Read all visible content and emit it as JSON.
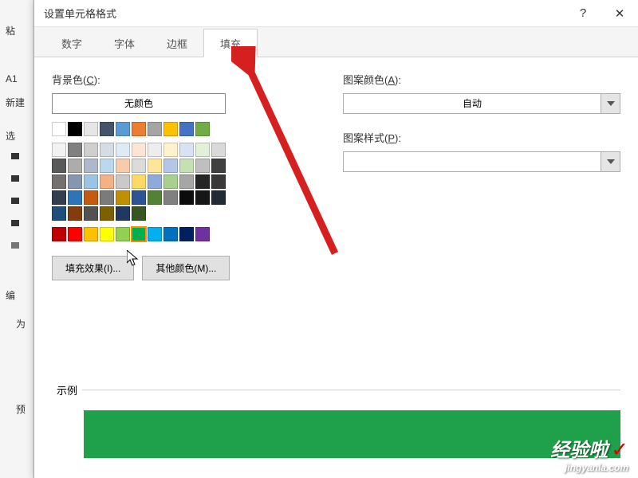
{
  "bg": {
    "paste": "粘",
    "a1": "A1",
    "new": "新建",
    "select": "选",
    "edit": "编",
    "for": "为",
    "preview": "预"
  },
  "dialog": {
    "title": "设置单元格格式",
    "help": "?",
    "close": "✕"
  },
  "tabs": {
    "number": "数字",
    "font": "字体",
    "border": "边框",
    "fill": "填充"
  },
  "fill": {
    "bg_label_pre": "背景色(",
    "bg_label_u": "C",
    "bg_label_post": "):",
    "no_color": "无颜色",
    "fill_effects": "填充效果(I)...",
    "more_colors": "其他颜色(M)...",
    "pattern_color_pre": "图案颜色(",
    "pattern_color_u": "A",
    "pattern_color_post": "):",
    "auto": "自动",
    "pattern_style_pre": "图案样式(",
    "pattern_style_u": "P",
    "pattern_style_post": "):",
    "sample": "示例"
  },
  "palette": {
    "row1": [
      "#ffffff",
      "#000000",
      "#e7e6e6",
      "#44546a",
      "#5b9bd5",
      "#ed7d31",
      "#a5a5a5",
      "#ffc000",
      "#4472c4",
      "#70ad47"
    ],
    "theme": [
      [
        "#f2f2f2",
        "#808080",
        "#d0cece",
        "#d6dce4",
        "#deebf6",
        "#fbe5d5",
        "#ededed",
        "#fff2cc",
        "#d9e2f3",
        "#e2efd9"
      ],
      [
        "#d9d9d9",
        "#595959",
        "#aeabab",
        "#adb9ca",
        "#bdd7ee",
        "#f7cbac",
        "#dbdbdb",
        "#fee599",
        "#b4c6e7",
        "#c5e0b3"
      ],
      [
        "#bfbfbf",
        "#404040",
        "#757070",
        "#8496b0",
        "#9cc3e5",
        "#f4b183",
        "#c9c9c9",
        "#ffd965",
        "#8eaadb",
        "#a8d08d"
      ],
      [
        "#a6a6a6",
        "#262626",
        "#3a3838",
        "#323f4f",
        "#2e75b5",
        "#c55a11",
        "#7b7b7b",
        "#bf9000",
        "#2f5496",
        "#538135"
      ],
      [
        "#808080",
        "#0c0c0c",
        "#171616",
        "#222a35",
        "#1e4e79",
        "#833c0b",
        "#525252",
        "#7f6000",
        "#1f3864",
        "#375623"
      ]
    ],
    "standard": [
      "#c00000",
      "#ff0000",
      "#ffc000",
      "#ffff00",
      "#92d050",
      "#00b050",
      "#00b0f0",
      "#0070c0",
      "#002060",
      "#7030a0"
    ],
    "selected": "#00b050"
  },
  "sample_color": "#1fa04a",
  "watermark": {
    "main": "经验啦",
    "sub": "jingyanla.com",
    "check": "✓"
  }
}
